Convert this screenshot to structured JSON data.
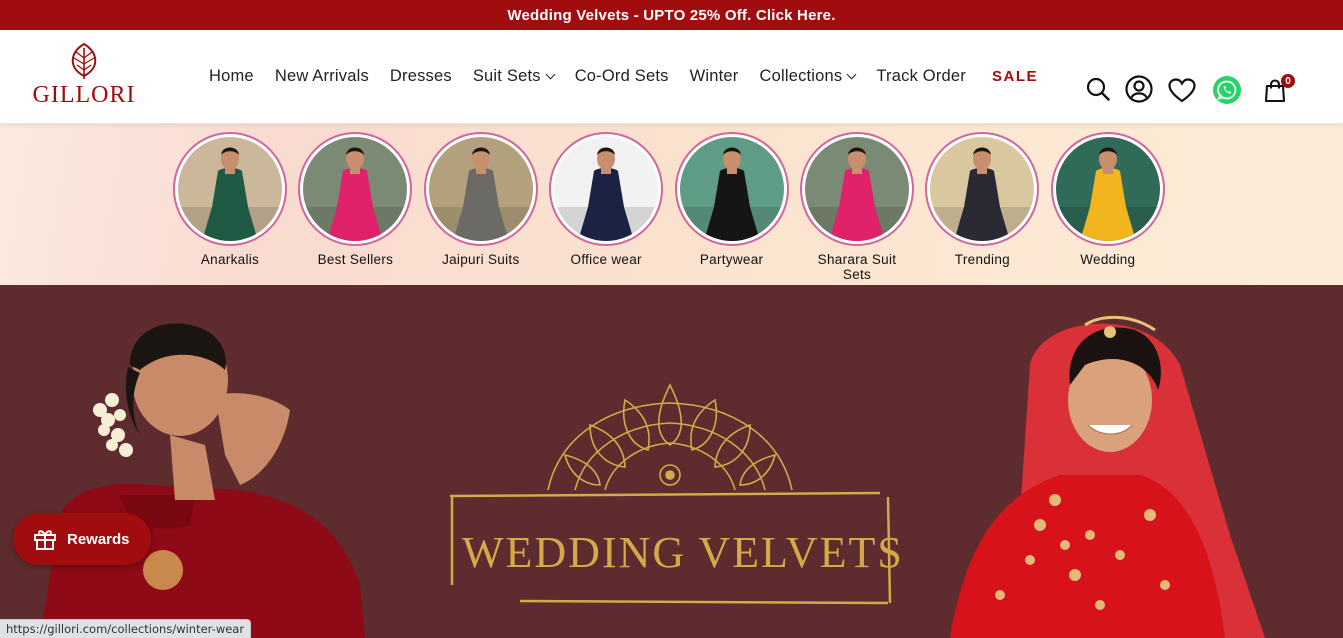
{
  "announcement": "Wedding Velvets - UPTO 25% Off. Click Here.",
  "brand": {
    "name": "GILLORI",
    "color": "#a10d0e"
  },
  "nav": {
    "items": [
      {
        "label": "Home",
        "dropdown": false
      },
      {
        "label": "New Arrivals",
        "dropdown": false
      },
      {
        "label": "Dresses",
        "dropdown": false
      },
      {
        "label": "Suit Sets",
        "dropdown": true
      },
      {
        "label": "Co-Ord Sets",
        "dropdown": false
      },
      {
        "label": "Winter",
        "dropdown": false
      },
      {
        "label": "Collections",
        "dropdown": true
      },
      {
        "label": "Track Order",
        "dropdown": false
      }
    ],
    "sale": "SALE"
  },
  "header_icons": [
    "search-icon",
    "account-icon",
    "wishlist-heart-icon",
    "whatsapp-icon",
    "cart-bag-icon"
  ],
  "cart": {
    "count": "0"
  },
  "collections": [
    {
      "label": "Anarkalis",
      "bg": "#cbb79a",
      "dress": "#1f5a44"
    },
    {
      "label": "Best Sellers",
      "bg": "#7b8a74",
      "dress": "#e0226b"
    },
    {
      "label": "Jaipuri Suits",
      "bg": "#b3a17d",
      "dress": "#6b6a66"
    },
    {
      "label": "Office wear",
      "bg": "#f2f2f2",
      "dress": "#1b2244"
    },
    {
      "label": "Partywear",
      "bg": "#5f9c86",
      "dress": "#151515"
    },
    {
      "label": "Sharara Suit Sets",
      "bg": "#7b8a74",
      "dress": "#e0226b"
    },
    {
      "label": "Trending",
      "bg": "#d9c7a0",
      "dress": "#2a2a35"
    },
    {
      "label": "Wedding",
      "bg": "#2f6b58",
      "dress": "#f2b51e"
    }
  ],
  "hero": {
    "title": "WEDDING VELVETS",
    "bg_color": "#5e2c2e",
    "accent_gold": "#d4a94a"
  },
  "rewards": {
    "label": "Rewards"
  },
  "status_bar": {
    "url": "https://gillori.com/collections/winter-wear"
  }
}
